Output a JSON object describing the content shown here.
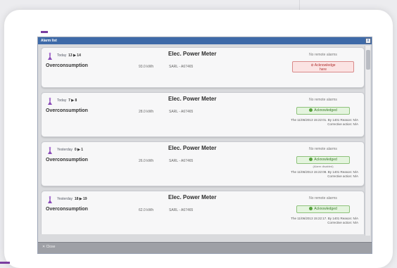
{
  "window": {
    "title": "Alarm list",
    "close_glyph": "x"
  },
  "footer": {
    "close_label": "✕ Close"
  },
  "alarms": [
    {
      "day": "Today",
      "range": "13 ▶ 14",
      "meter": "Elec. Power Meter",
      "type": "Overconsumption",
      "value": "93.0 kWh",
      "ref": "SARL - A67465",
      "remote": "No remote alarms",
      "ack_button": {
        "line1": "⊘ Acknowledge",
        "line2": "here"
      }
    },
    {
      "day": "Today",
      "range": "7 ▶ 8",
      "meter": "Elec. Power Meter",
      "type": "Overconsumption",
      "value": "28.0 kWh",
      "ref": "SARL - A67465",
      "remote": "No remote alarms",
      "status": "Acknowledged",
      "detail": {
        "line1": "The 11/06/2013 15:22:01. By 1401 Reason: N/A",
        "line2": "Corrective action: N/A"
      }
    },
    {
      "day": "Yesterday",
      "range": "0 ▶ 1",
      "meter": "Elec. Power Meter",
      "type": "Overconsumption",
      "value": "26.0 kWh",
      "ref": "SARL - A67465",
      "remote": "No remote alarms",
      "status": "Acknowledged",
      "disabled": "(Alarm disabled)",
      "detail": {
        "line1": "The 11/06/2013 15:22:08. By 1401 Reason: N/A",
        "line2": "Corrective action: N/A"
      }
    },
    {
      "day": "Yesterday",
      "range": "18 ▶ 19",
      "meter": "Elec. Power Meter",
      "type": "Overconsumption",
      "value": "62.0 kWh",
      "ref": "SARL - A67465",
      "remote": "No remote alarms",
      "status": "Acknowledged",
      "detail": {
        "line1": "The 11/06/2013 15:22:17. By 1401 Reason: N/A",
        "line2": "Corrective action: N/A"
      }
    }
  ],
  "colors": {
    "titlebar": "#3e6aa8",
    "accent": "#7a3ea0",
    "ack_pending": "#b03030",
    "ack_done": "#3a7d2a"
  },
  "icons": {
    "alarm": "meter-pin-icon",
    "close": "close-icon",
    "check": "check-dot-icon"
  }
}
